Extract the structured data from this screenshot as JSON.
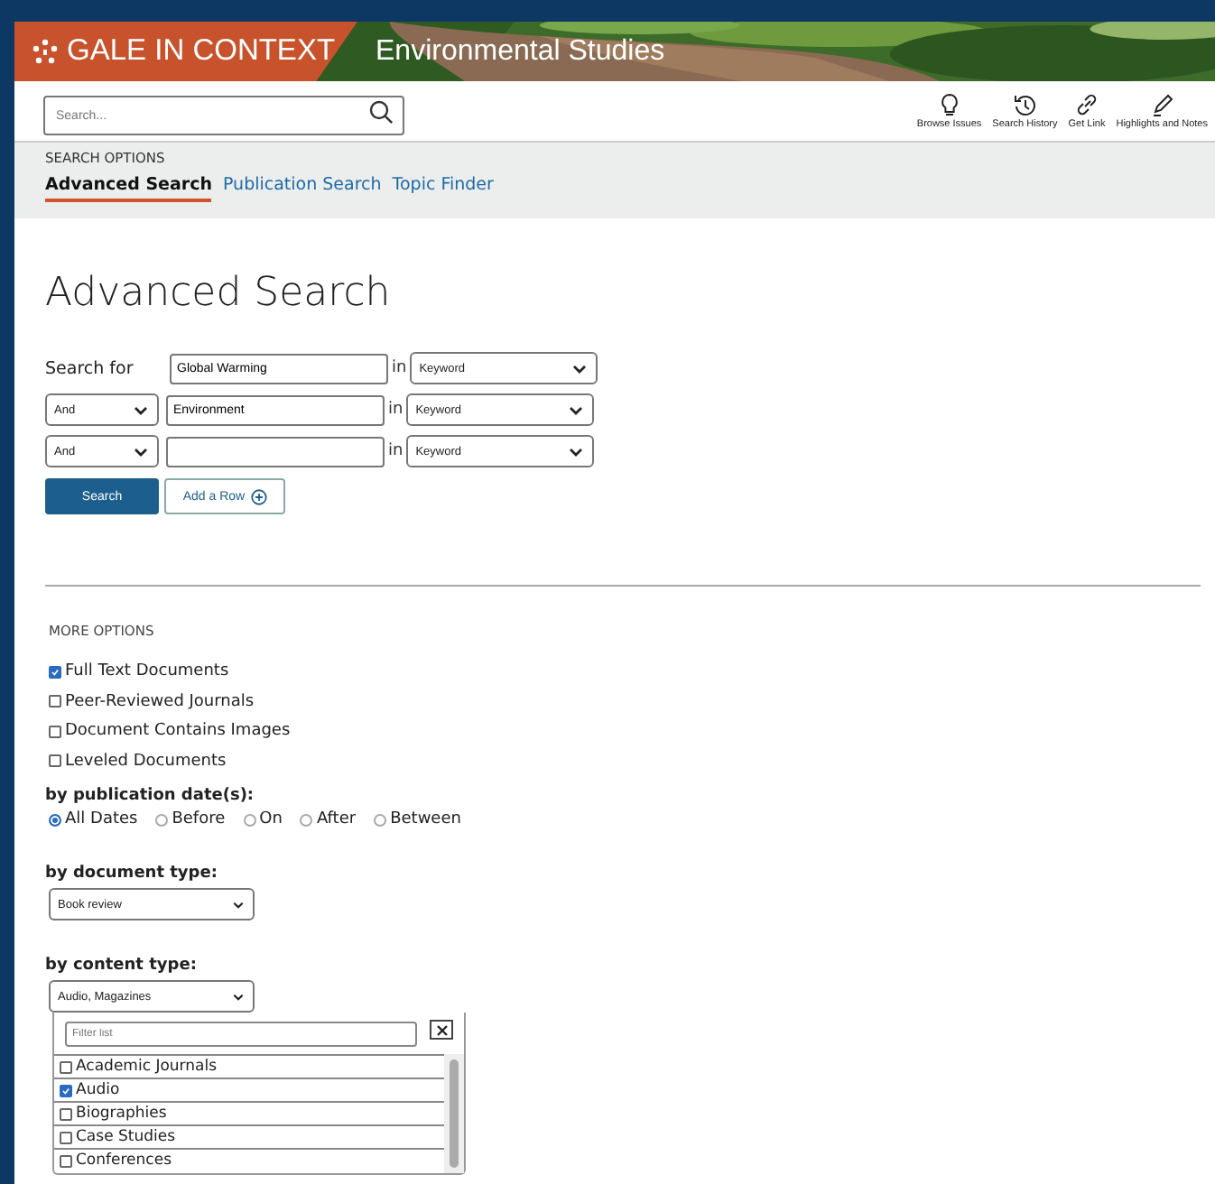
{
  "banner": {
    "brand": "GALE IN CONTEXT",
    "product": "Environmental Studies"
  },
  "toolbar": {
    "search": {
      "placeholder": "Search..."
    },
    "tools": [
      {
        "label": "Browse Issues",
        "kind": "bulb"
      },
      {
        "label": "Search History",
        "kind": "history"
      },
      {
        "label": "Get Link",
        "kind": "link"
      },
      {
        "label": "Highlights and Notes",
        "kind": "pen"
      }
    ]
  },
  "search_options": {
    "heading": "SEARCH OPTIONS",
    "tabs": [
      {
        "label": "Advanced Search",
        "selected": true
      },
      {
        "label": "Publication Search",
        "selected": false
      },
      {
        "label": "Topic Finder",
        "selected": false
      }
    ]
  },
  "title": "Advanced Search",
  "search_rows": [
    {
      "label": "Search for",
      "value": "Global Warming",
      "connector": "in",
      "field": "Keyword"
    },
    {
      "operator": "And",
      "value": "Environment",
      "connector": "in",
      "field": "Keyword"
    },
    {
      "operator": "And",
      "connector": "in",
      "field": "Keyword"
    }
  ],
  "buttons": [
    {
      "label": "Search",
      "kind": "primary"
    },
    {
      "label": "Add a Row",
      "kind": "add"
    }
  ],
  "more_options": {
    "heading": "MORE OPTIONS",
    "checkboxes": [
      {
        "label": "Full Text Documents",
        "checked": true
      },
      {
        "label": "Peer-Reviewed Journals",
        "checked": false
      },
      {
        "label": "Document Contains Images",
        "checked": false
      },
      {
        "label": "Leveled Documents",
        "checked": false
      }
    ],
    "date_heading": "by publication date(s):",
    "dates": [
      {
        "label": "All Dates",
        "selected": true
      },
      {
        "label": "Before",
        "selected": false
      },
      {
        "label": "On",
        "selected": false
      },
      {
        "label": "After",
        "selected": false
      },
      {
        "label": "Between",
        "selected": false
      }
    ],
    "document_type": {
      "heading": "by document type:",
      "value": "Book review"
    },
    "content_type": {
      "heading": "by content type:",
      "value": "Audio, Magazines",
      "dropdown": {
        "placeholder": "Filter list",
        "items": [
          {
            "label": "Academic Journals",
            "checked": false
          },
          {
            "label": "Audio",
            "checked": true
          },
          {
            "label": "Biographies",
            "checked": false
          },
          {
            "label": "Case Studies",
            "checked": false
          },
          {
            "label": "Conferences",
            "checked": false
          }
        ]
      }
    }
  }
}
